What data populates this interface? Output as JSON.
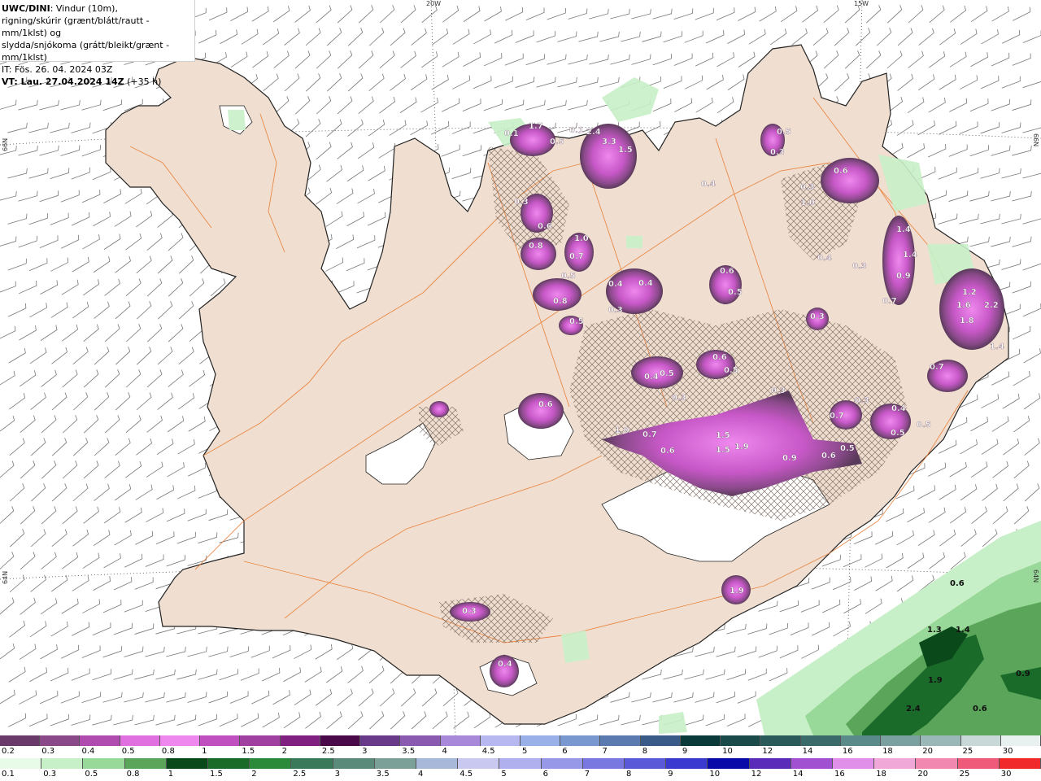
{
  "header": {
    "line1_bold": "UWC/DINI",
    "line1_rest": ": Vindur (10m),",
    "line2": "rigning/skúrir (grænt/blátt/rautt - mm/1klst) og",
    "line3": "slydda/snjókoma (grátt/bleikt/grænt - mm/1klst)",
    "line4": "IT: Fös. 26. 04. 2024 03Z",
    "line5_bold": "VT: Lau. 27.04.2024 14Z",
    "line5_rest": " (+35 h)"
  },
  "grid_labels": {
    "lon_20w": "20W",
    "lon_15w": "15W",
    "lat_66_left": "66N",
    "lat_66_right": "66N",
    "lat_64_left": "64N",
    "lat_64_right": "64N"
  },
  "colors": {
    "land": "#f0dfd0",
    "sea": "#ffffff",
    "roads": "#e8782e",
    "coast": "#222222",
    "snow_purple_light": "#e878e8",
    "snow_purple_mid": "#b04cb0",
    "snow_purple_dark": "#6a3a6a",
    "rain_green_light": "#c8f0c8",
    "rain_green_mid": "#5aa55a",
    "rain_green_dark": "#0a4a1a"
  },
  "precip_labels": [
    {
      "text": "0.1"
    },
    {
      "text": "1.7"
    },
    {
      "text": "0.5"
    },
    {
      "text": "0.1"
    },
    {
      "text": "2.4"
    },
    {
      "text": "3.3"
    },
    {
      "text": "1.5"
    },
    {
      "text": "0.3"
    },
    {
      "text": "0.6"
    },
    {
      "text": "0.8"
    },
    {
      "text": "1.0"
    },
    {
      "text": "0.7"
    },
    {
      "text": "0.5"
    },
    {
      "text": "0.8"
    },
    {
      "text": "0.5"
    },
    {
      "text": "0.4"
    },
    {
      "text": "0.4"
    },
    {
      "text": "0.3"
    },
    {
      "text": "0.6"
    },
    {
      "text": "0.5"
    },
    {
      "text": "0.4"
    },
    {
      "text": "0.5"
    },
    {
      "text": "0.3"
    },
    {
      "text": "0.3"
    },
    {
      "text": "1.0"
    },
    {
      "text": "0.6"
    },
    {
      "text": "1.4"
    },
    {
      "text": "1.4"
    },
    {
      "text": "0.9"
    },
    {
      "text": "0.7"
    },
    {
      "text": "0.4"
    },
    {
      "text": "0.3"
    },
    {
      "text": "0.3"
    },
    {
      "text": "1.2"
    },
    {
      "text": "1.6"
    },
    {
      "text": "2.2"
    },
    {
      "text": "1.8"
    },
    {
      "text": "1.4"
    },
    {
      "text": "0.7"
    },
    {
      "text": "0.6"
    },
    {
      "text": "0.5"
    },
    {
      "text": "0.4"
    },
    {
      "text": "0.5"
    },
    {
      "text": "0.3"
    },
    {
      "text": "0.3"
    },
    {
      "text": "0.6"
    },
    {
      "text": "1.0"
    },
    {
      "text": "0.7"
    },
    {
      "text": "0.6"
    },
    {
      "text": "1.5"
    },
    {
      "text": "1.5"
    },
    {
      "text": "1.9"
    },
    {
      "text": "0.9"
    },
    {
      "text": "0.6"
    },
    {
      "text": "0.5"
    },
    {
      "text": "0.3"
    },
    {
      "text": "0.7"
    },
    {
      "text": "0.4"
    },
    {
      "text": "0.5"
    },
    {
      "text": "0.5"
    },
    {
      "text": "0.3"
    },
    {
      "text": "0.4"
    },
    {
      "text": "1.9"
    },
    {
      "text": "0.6"
    },
    {
      "text": "1.3"
    },
    {
      "text": "1.4"
    },
    {
      "text": "1.9"
    },
    {
      "text": "2.4"
    },
    {
      "text": "0.6"
    },
    {
      "text": "0.9"
    }
  ],
  "scale_top": {
    "legend": "snow / sleet (grey/pink/green)",
    "bins": [
      {
        "label": "0.2",
        "color": "#6a3a6a"
      },
      {
        "label": "0.3",
        "color": "#8a4a8a"
      },
      {
        "label": "0.4",
        "color": "#b04cb0"
      },
      {
        "label": "0.5",
        "color": "#e070e0"
      },
      {
        "label": "0.8",
        "color": "#ee88ee"
      },
      {
        "label": "1",
        "color": "#c050c0"
      },
      {
        "label": "1.5",
        "color": "#a040a0"
      },
      {
        "label": "2",
        "color": "#802080"
      },
      {
        "label": "2.5",
        "color": "#4a0a4a"
      },
      {
        "label": "3",
        "color": "#6a3a8a"
      },
      {
        "label": "3.5",
        "color": "#8a5ab0"
      },
      {
        "label": "4",
        "color": "#a888d8"
      },
      {
        "label": "4.5",
        "color": "#b8b8f0"
      },
      {
        "label": "5",
        "color": "#9ab0e8"
      },
      {
        "label": "6",
        "color": "#7a98d0"
      },
      {
        "label": "7",
        "color": "#5a7ab0"
      },
      {
        "label": "8",
        "color": "#3a5a88"
      },
      {
        "label": "9",
        "color": "#0a3a3a"
      },
      {
        "label": "10",
        "color": "#1a4a4a"
      },
      {
        "label": "12",
        "color": "#2a5a5a"
      },
      {
        "label": "14",
        "color": "#3a6a6a"
      },
      {
        "label": "16",
        "color": "#5a8a8a"
      },
      {
        "label": "18",
        "color": "#7aa0a0"
      },
      {
        "label": "20",
        "color": "#9ab8b8"
      },
      {
        "label": "25",
        "color": "#c8d8d8"
      },
      {
        "label": "30",
        "color": "#e8f0f0"
      }
    ]
  },
  "scale_bottom": {
    "legend": "rain / showers (green/blue/red)",
    "bins": [
      {
        "label": "0.1",
        "color": "#e8fbe8"
      },
      {
        "label": "0.3",
        "color": "#c8f0c8"
      },
      {
        "label": "0.5",
        "color": "#98d898"
      },
      {
        "label": "0.8",
        "color": "#5aa55a"
      },
      {
        "label": "1",
        "color": "#0a4a1a"
      },
      {
        "label": "1.5",
        "color": "#1a6a2a"
      },
      {
        "label": "2",
        "color": "#2a8a3a"
      },
      {
        "label": "2.5",
        "color": "#3a7a5a"
      },
      {
        "label": "3",
        "color": "#5a8a7a"
      },
      {
        "label": "3.5",
        "color": "#7aa098"
      },
      {
        "label": "4",
        "color": "#a8b8d8"
      },
      {
        "label": "4.5",
        "color": "#c8c8f0"
      },
      {
        "label": "5",
        "color": "#b0b0ee"
      },
      {
        "label": "6",
        "color": "#9898e8"
      },
      {
        "label": "7",
        "color": "#7878e0"
      },
      {
        "label": "8",
        "color": "#5a5ad8"
      },
      {
        "label": "9",
        "color": "#3a3ad0"
      },
      {
        "label": "10",
        "color": "#0a0aa8"
      },
      {
        "label": "12",
        "color": "#5a2ab8"
      },
      {
        "label": "14",
        "color": "#a050d0"
      },
      {
        "label": "16",
        "color": "#e090e8"
      },
      {
        "label": "18",
        "color": "#f0a8d8"
      },
      {
        "label": "20",
        "color": "#f088b0"
      },
      {
        "label": "25",
        "color": "#f05a7a"
      },
      {
        "label": "30",
        "color": "#f02a2a"
      }
    ]
  }
}
